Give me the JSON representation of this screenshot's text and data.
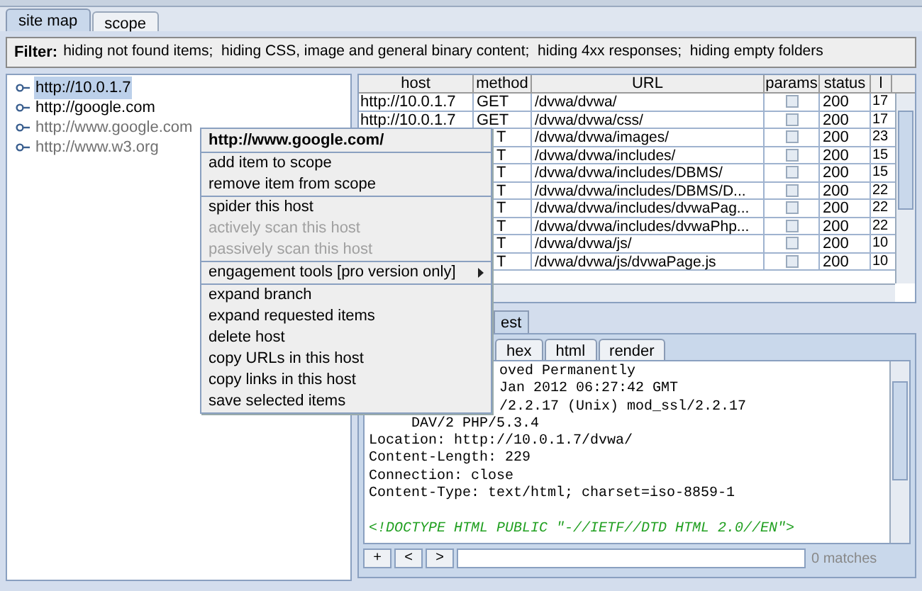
{
  "tabs": [
    {
      "label": "site map",
      "selected": true
    },
    {
      "label": "scope",
      "selected": false
    }
  ],
  "filter": {
    "label": "Filter:",
    "text": "hiding not found items;  hiding CSS, image and general binary content;  hiding 4xx responses;  hiding empty folders"
  },
  "tree": [
    {
      "label": "http://10.0.1.7",
      "selected": true,
      "dimmed": false
    },
    {
      "label": "http://google.com",
      "selected": false,
      "dimmed": false
    },
    {
      "label": "http://www.google.com",
      "selected": false,
      "dimmed": true
    },
    {
      "label": "http://www.w3.org",
      "selected": false,
      "dimmed": true
    }
  ],
  "table": {
    "columns": [
      "host",
      "method",
      "URL",
      "params",
      "status",
      "l"
    ],
    "rows": [
      {
        "host": "http://10.0.1.7",
        "method": "GET",
        "url": "/dvwa/dvwa/",
        "params": false,
        "status": "200",
        "column_6": "17"
      },
      {
        "host": "http://10.0.1.7",
        "method": "GET",
        "url": "/dvwa/dvwa/css/",
        "params": false,
        "status": "200",
        "column_6": "17"
      },
      {
        "method": "T",
        "url": "/dvwa/dvwa/images/",
        "params": false,
        "status": "200",
        "column_6": "23"
      },
      {
        "method": "T",
        "url": "/dvwa/dvwa/includes/",
        "params": false,
        "status": "200",
        "column_6": "15"
      },
      {
        "method": "T",
        "url": "/dvwa/dvwa/includes/DBMS/",
        "params": false,
        "status": "200",
        "column_6": "15"
      },
      {
        "method": "T",
        "url": "/dvwa/dvwa/includes/DBMS/D...",
        "params": false,
        "status": "200",
        "column_6": "22"
      },
      {
        "method": "T",
        "url": "/dvwa/dvwa/includes/dvwaPag...",
        "params": false,
        "status": "200",
        "column_6": "22"
      },
      {
        "method": "T",
        "url": "/dvwa/dvwa/includes/dvwaPhp...",
        "params": false,
        "status": "200",
        "column_6": "22"
      },
      {
        "method": "T",
        "url": "/dvwa/dvwa/js/",
        "params": false,
        "status": "200",
        "column_6": "10"
      },
      {
        "method": "T",
        "url": "/dvwa/dvwa/js/dvwaPage.js",
        "params": false,
        "status": "200",
        "column_6": "10"
      }
    ]
  },
  "message_tabs": [
    {
      "label": "est",
      "selected": true
    }
  ],
  "view_tabs": [
    {
      "label": "hex",
      "selected": false
    },
    {
      "label": "html",
      "selected": false
    },
    {
      "label": "render",
      "selected": false
    }
  ],
  "message_lines": [
    {
      "text": "oved Permanently",
      "kind": "cut"
    },
    {
      "text": "Jan 2012 06:27:42 GMT",
      "kind": "cut"
    },
    {
      "text": "/2.2.17 (Unix) mod_ssl/2.2.17",
      "kind": "cut"
    },
    {
      "text": "DAV/2 PHP/5.3.4",
      "kind": "tail"
    },
    {
      "text": "Location: http://10.0.1.7/dvwa/",
      "kind": "header"
    },
    {
      "text": "Content-Length: 229",
      "kind": "header"
    },
    {
      "text": "Connection: close",
      "kind": "header"
    },
    {
      "text": "Content-Type: text/html; charset=iso-8859-1",
      "kind": "header"
    },
    {
      "kind": "blank"
    },
    {
      "text": "<!DOCTYPE HTML PUBLIC \"-//IETF//DTD HTML 2.0//EN\">",
      "kind": "doctype"
    }
  ],
  "search_bar": {
    "buttons": [
      "+",
      "<",
      ">"
    ],
    "matches": "0 matches"
  },
  "context_menu": {
    "title": "http://www.google.com/",
    "groups": [
      [
        {
          "label": "add item to scope",
          "disabled": false,
          "submenu": false
        },
        {
          "label": "remove item from scope",
          "disabled": false,
          "submenu": false
        }
      ],
      [
        {
          "label": "spider this host",
          "disabled": false,
          "submenu": false
        },
        {
          "label": "actively scan this host",
          "disabled": true,
          "submenu": false
        },
        {
          "label": "passively scan this host",
          "disabled": true,
          "submenu": false
        }
      ],
      [
        {
          "label": "engagement tools [pro version only]",
          "disabled": false,
          "submenu": true
        }
      ],
      [
        {
          "label": "expand branch",
          "disabled": false,
          "submenu": false
        },
        {
          "label": "expand requested items",
          "disabled": false,
          "submenu": false
        },
        {
          "label": "delete host",
          "disabled": false,
          "submenu": false
        },
        {
          "label": "copy URLs in this host",
          "disabled": false,
          "submenu": false
        },
        {
          "label": "copy links in this host",
          "disabled": false,
          "submenu": false
        },
        {
          "label": "save selected items",
          "disabled": false,
          "submenu": false
        }
      ]
    ]
  }
}
